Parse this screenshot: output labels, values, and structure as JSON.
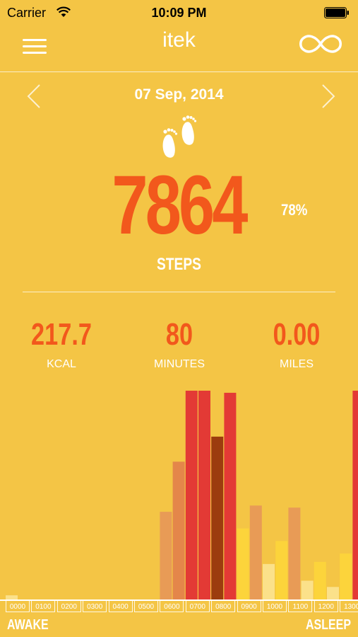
{
  "status": {
    "carrier": "Carrier",
    "time": "10:09 PM"
  },
  "header": {
    "title": "itek",
    "menu_icon": "hamburger-menu-icon",
    "sync_icon": "infinity-icon"
  },
  "date_nav": {
    "date": "07 Sep, 2014",
    "prev_icon": "chevron-left-icon",
    "next_icon": "chevron-right-icon"
  },
  "steps": {
    "value": "7864",
    "percent": "78%",
    "label": "STEPS",
    "icon": "footprints-icon"
  },
  "stats": [
    {
      "value": "217.7",
      "label": "KCAL"
    },
    {
      "value": "80",
      "label": "MINUTES"
    },
    {
      "value": "0.00",
      "label": "MILES"
    }
  ],
  "colors": {
    "background": "#F4C545",
    "accent": "#F2581C",
    "red": "#E33A35",
    "dark_red": "#9C3C0E",
    "orange": "#E4864A",
    "orange_light": "#E89B56",
    "yellow": "#FCD43B",
    "pale": "#FBE18A"
  },
  "chart_data": {
    "type": "bar",
    "categories": [
      "0000",
      "0100",
      "0200",
      "0300",
      "0400",
      "0500",
      "0600",
      "0700",
      "0800",
      "0900",
      "1000",
      "1100",
      "1200",
      "1300"
    ],
    "ylim": [
      0,
      100
    ],
    "bars": [
      {
        "slot": 0.0,
        "value": 2,
        "color": "#FBE18A"
      },
      {
        "slot": 6.0,
        "value": 42,
        "color": "#E89B56"
      },
      {
        "slot": 6.5,
        "value": 66,
        "color": "#E4864A"
      },
      {
        "slot": 7.0,
        "value": 100,
        "color": "#E33A35"
      },
      {
        "slot": 7.5,
        "value": 100,
        "color": "#E33A35"
      },
      {
        "slot": 8.0,
        "value": 78,
        "color": "#9C3C0E"
      },
      {
        "slot": 8.5,
        "value": 99,
        "color": "#E33A35"
      },
      {
        "slot": 9.0,
        "value": 34,
        "color": "#FCD43B"
      },
      {
        "slot": 9.5,
        "value": 45,
        "color": "#E89B56"
      },
      {
        "slot": 10.0,
        "value": 17,
        "color": "#FBE18A"
      },
      {
        "slot": 10.5,
        "value": 28,
        "color": "#FCD43B"
      },
      {
        "slot": 11.0,
        "value": 44,
        "color": "#E89B56"
      },
      {
        "slot": 11.5,
        "value": 9,
        "color": "#FBE18A"
      },
      {
        "slot": 12.0,
        "value": 18,
        "color": "#FCD43B"
      },
      {
        "slot": 12.5,
        "value": 6,
        "color": "#FBE18A"
      },
      {
        "slot": 13.0,
        "value": 22,
        "color": "#FCD43B"
      },
      {
        "slot": 13.5,
        "value": 100,
        "color": "#E33A35"
      }
    ],
    "legend": {
      "left": "AWAKE",
      "right": "ASLEEP"
    }
  }
}
